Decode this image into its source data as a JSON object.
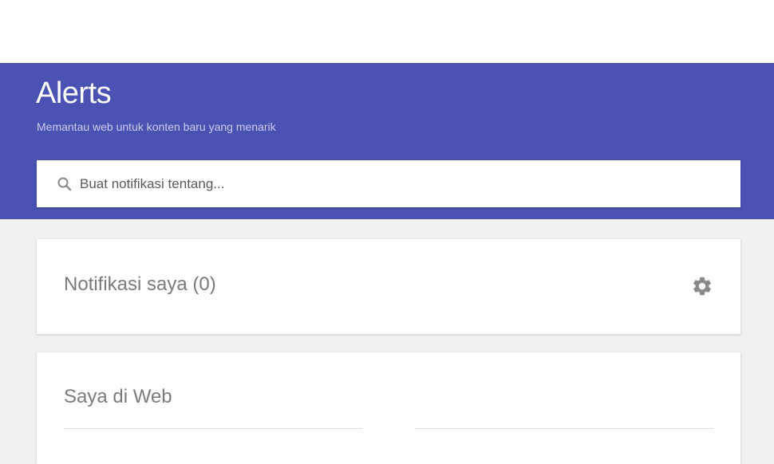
{
  "header": {
    "title": "Alerts",
    "subtitle": "Memantau web untuk konten baru yang menarik",
    "background_color": "#4a52b3"
  },
  "search": {
    "placeholder": "Buat notifikasi tentang...",
    "value": "",
    "icon": "search-icon"
  },
  "my_alerts": {
    "label": "Notifikasi saya",
    "count_text": "(0)",
    "settings_icon": "gear-icon"
  },
  "me_on_web": {
    "label": "Saya di Web"
  }
}
